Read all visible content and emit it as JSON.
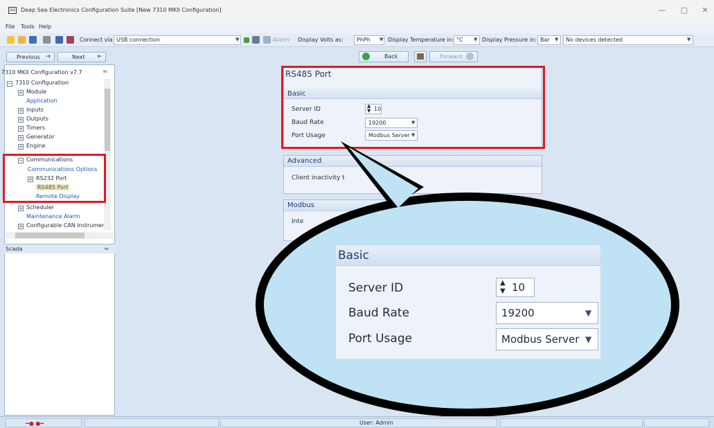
{
  "window": {
    "title": "Deep Sea Electronics Configuration Suite [New 7310 MKII Configuration]",
    "app_icon_text": "DSE",
    "minimize": "—",
    "maximize": "▢",
    "close": "✕"
  },
  "menu": [
    "File",
    "Tools",
    "Help"
  ],
  "toolbar": {
    "connect_label": "Connect via",
    "connect_value": "USB connection",
    "alarm_label": "Alarm",
    "volts_label": "Display Volts as:",
    "volts_value": "PhPh",
    "temp_label": "Display Temperature in:",
    "temp_value": "°C",
    "pressure_label": "Display Pressure in:",
    "pressure_value": "Bar",
    "devices_value": "No devices detected"
  },
  "nav": {
    "previous": "Previous",
    "next": "Next"
  },
  "tree": {
    "header": "7310 MKII Configuration v7.7",
    "items": [
      "7310 Configuration",
      "Module",
      "Application",
      "Inputs",
      "Outputs",
      "Timers",
      "Generator",
      "Engine",
      "Communications",
      "Communications Options",
      "RS232 Port",
      "RS485 Port",
      "Remote Display",
      "Scheduler",
      "Maintenance Alarm",
      "Configurable CAN Instrument"
    ]
  },
  "scada": "Scada",
  "content_nav": {
    "back": "Back",
    "forward": "Forward"
  },
  "page": {
    "title": "RS485 Port",
    "basic": {
      "head": "Basic",
      "server_id_label": "Server ID",
      "server_id_value": "10",
      "baud_label": "Baud Rate",
      "baud_value": "19200",
      "usage_label": "Port Usage",
      "usage_value": "Modbus Server"
    },
    "advanced": {
      "head": "Advanced",
      "client_label_partial": "Client inactivity t"
    },
    "modbus": {
      "head": "Modbus",
      "partial": "Inte"
    }
  },
  "status": {
    "user": "User: Admin"
  }
}
